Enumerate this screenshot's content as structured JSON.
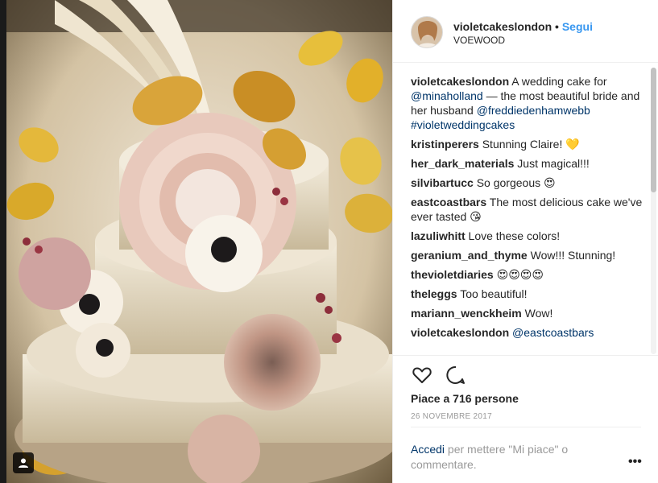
{
  "header": {
    "username": "violetcakeslondon",
    "separator": "•",
    "follow_label": "Segui",
    "location": "VOEWOOD"
  },
  "caption": {
    "username": "violetcakeslondon",
    "text_start": " A wedding cake for ",
    "mention1": "@minaholland",
    "text_mid": " — the most beautiful bride and her husband ",
    "mention2": "@freddiedenhamwebb",
    "hashtag": "#violetweddingcakes"
  },
  "comments": [
    {
      "user": "kristinperers",
      "text": " Stunning Claire! 💛"
    },
    {
      "user": "her_dark_materials",
      "text": " Just magical!!!"
    },
    {
      "user": "silvibartucc",
      "text": " So gorgeous 😍"
    },
    {
      "user": "eastcoastbars",
      "text": " The most delicious cake we've ever tasted 😘"
    },
    {
      "user": "lazuliwhitt",
      "text": " Love these colors!"
    },
    {
      "user": "geranium_and_thyme",
      "text": " Wow!!! Stunning!"
    },
    {
      "user": "thevioletdiaries",
      "text": " 😍😍😍😍"
    },
    {
      "user": "theleggs",
      "text": " Too beautiful!"
    },
    {
      "user": "mariann_wenckheim",
      "text": " Wow!"
    }
  ],
  "last_comment": {
    "user": "violetcakeslondon",
    "mention": "@eastcoastbars"
  },
  "likes": "Piace a 716 persone",
  "date": "26 NOVEMBRE 2017",
  "login": {
    "link": "Accedi",
    "text": " per mettere \"Mi piace\" o commentare."
  },
  "more": "•••",
  "icons": {
    "like": "heart-icon",
    "comment": "comment-bubble-icon",
    "tag": "user-tag-icon",
    "more": "more-options-icon"
  },
  "colors": {
    "accent": "#3897f0",
    "link": "#003569",
    "muted": "#999999"
  }
}
